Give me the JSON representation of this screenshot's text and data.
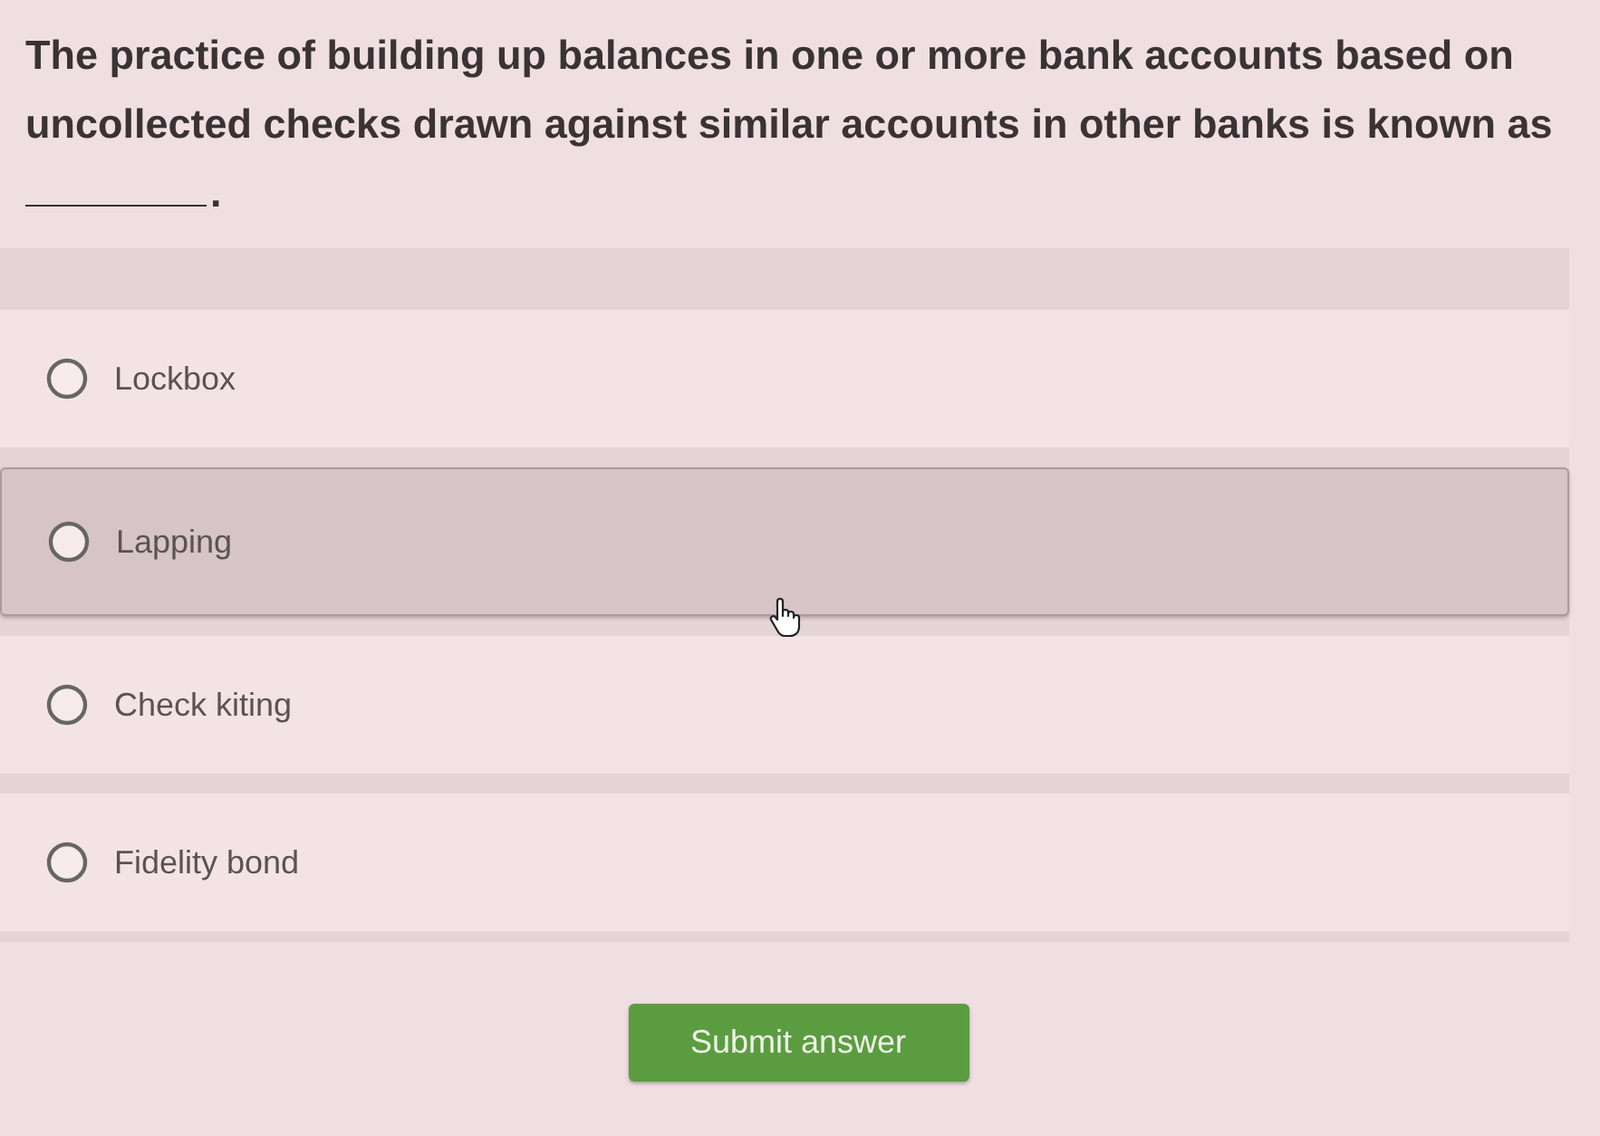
{
  "question": {
    "text": "The practice of building up balances in one or more bank accounts based on uncollected checks drawn against similar accounts in other banks is known as",
    "blank": true,
    "after_blank": "."
  },
  "options": [
    {
      "label": "Lockbox",
      "selected": false,
      "hovered": false
    },
    {
      "label": "Lapping",
      "selected": false,
      "hovered": true
    },
    {
      "label": "Check kiting",
      "selected": false,
      "hovered": false
    },
    {
      "label": "Fidelity bond",
      "selected": false,
      "hovered": false
    }
  ],
  "submit_button": {
    "label": "Submit answer"
  }
}
